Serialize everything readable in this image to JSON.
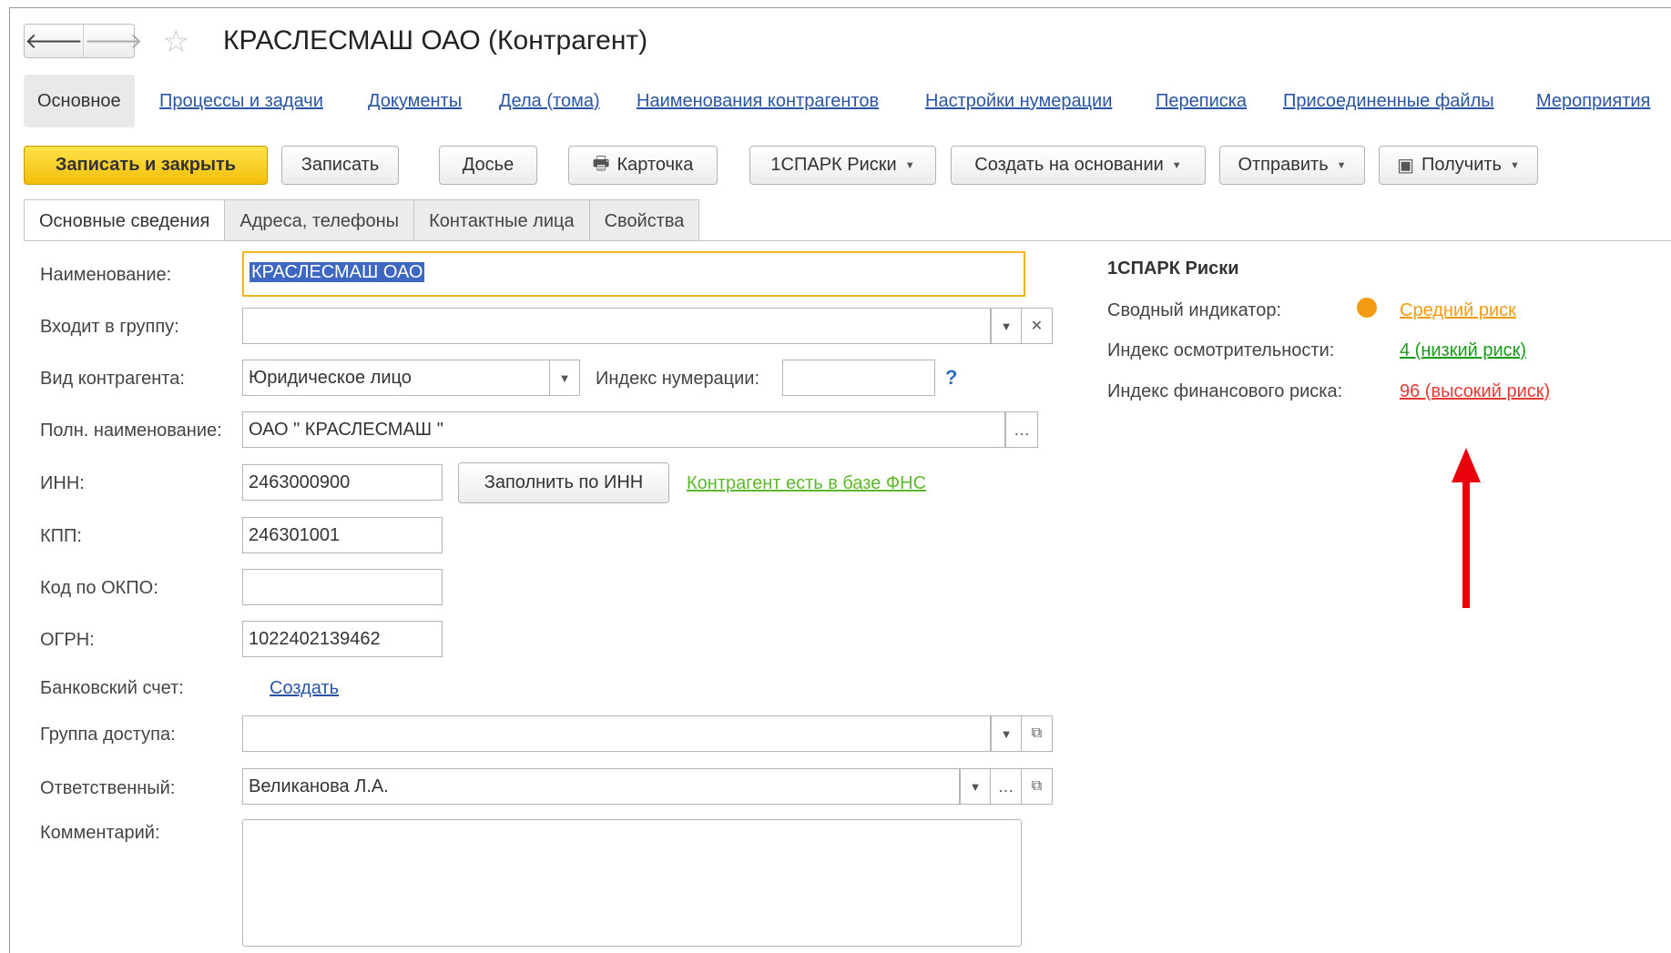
{
  "window": {
    "title": "КРАСЛЕСМАШ  ОАО (Контрагент)",
    "back_icon": "arrow-left-icon",
    "forward_icon": "arrow-right-icon",
    "star_icon": "star-outline-icon"
  },
  "nav": {
    "items": [
      {
        "label": "Основное",
        "active": true
      },
      {
        "label": "Процессы и задачи"
      },
      {
        "label": "Документы"
      },
      {
        "label": "Дела (тома)"
      },
      {
        "label": "Наименования контрагентов"
      },
      {
        "label": "Настройки нумерации"
      },
      {
        "label": "Переписка"
      },
      {
        "label": "Присоединенные файлы"
      },
      {
        "label": "Мероприятия"
      }
    ]
  },
  "toolbar": {
    "save_close": "Записать и закрыть",
    "save": "Записать",
    "dossier": "Досье",
    "card": "Карточка",
    "spark": "1СПАРК Риски",
    "create_based": "Создать на основании",
    "send": "Отправить",
    "receive": "Получить"
  },
  "tabs": [
    {
      "label": "Основные сведения",
      "active": true
    },
    {
      "label": "Адреса, телефоны"
    },
    {
      "label": "Контактные лица"
    },
    {
      "label": "Свойства"
    }
  ],
  "form": {
    "name_label": "Наименование:",
    "name_value": "КРАСЛЕСМАШ  ОАО",
    "group_label": "Входит в группу:",
    "group_value": "",
    "type_label": "Вид контрагента:",
    "type_value": "Юридическое лицо",
    "numbering_label": "Индекс нумерации:",
    "numbering_value": "",
    "help": "?",
    "fullname_label": "Полн. наименование:",
    "fullname_value": "ОАО  \" КРАСЛЕСМАШ \"",
    "inn_label": "ИНН:",
    "inn_value": "2463000900",
    "fill_inn": "Заполнить по ИНН",
    "fns_link": "Контрагент есть в базе ФНС",
    "kpp_label": "КПП:",
    "kpp_value": "246301001",
    "okpo_label": "Код по ОКПО:",
    "okpo_value": "",
    "ogrn_label": "ОГРН:",
    "ogrn_value": "1022402139462",
    "bank_label": "Банковский счет:",
    "bank_create": "Создать",
    "access_label": "Группа доступа:",
    "access_value": "",
    "resp_label": "Ответственный:",
    "resp_value": "Великанова Л.А.",
    "comment_label": "Комментарий:",
    "comment_value": ""
  },
  "spark": {
    "title": "1СПАРК Риски",
    "summary_label": "Сводный индикатор:",
    "summary_value": "Средний риск",
    "summary_color": "#f39c12",
    "diligence_label": "Индекс осмотрительности:",
    "diligence_value": "4 (низкий риск)",
    "diligence_color": "#1a9a1a",
    "finrisk_label": "Индекс финансового риска:",
    "finrisk_value": "96 (высокий риск)",
    "finrisk_color": "#e53935"
  },
  "colors": {
    "link": "#2a55a4",
    "fns_link": "#5cb82a",
    "primary_button": "#f5c518",
    "annotation_arrow": "#e8000b"
  }
}
